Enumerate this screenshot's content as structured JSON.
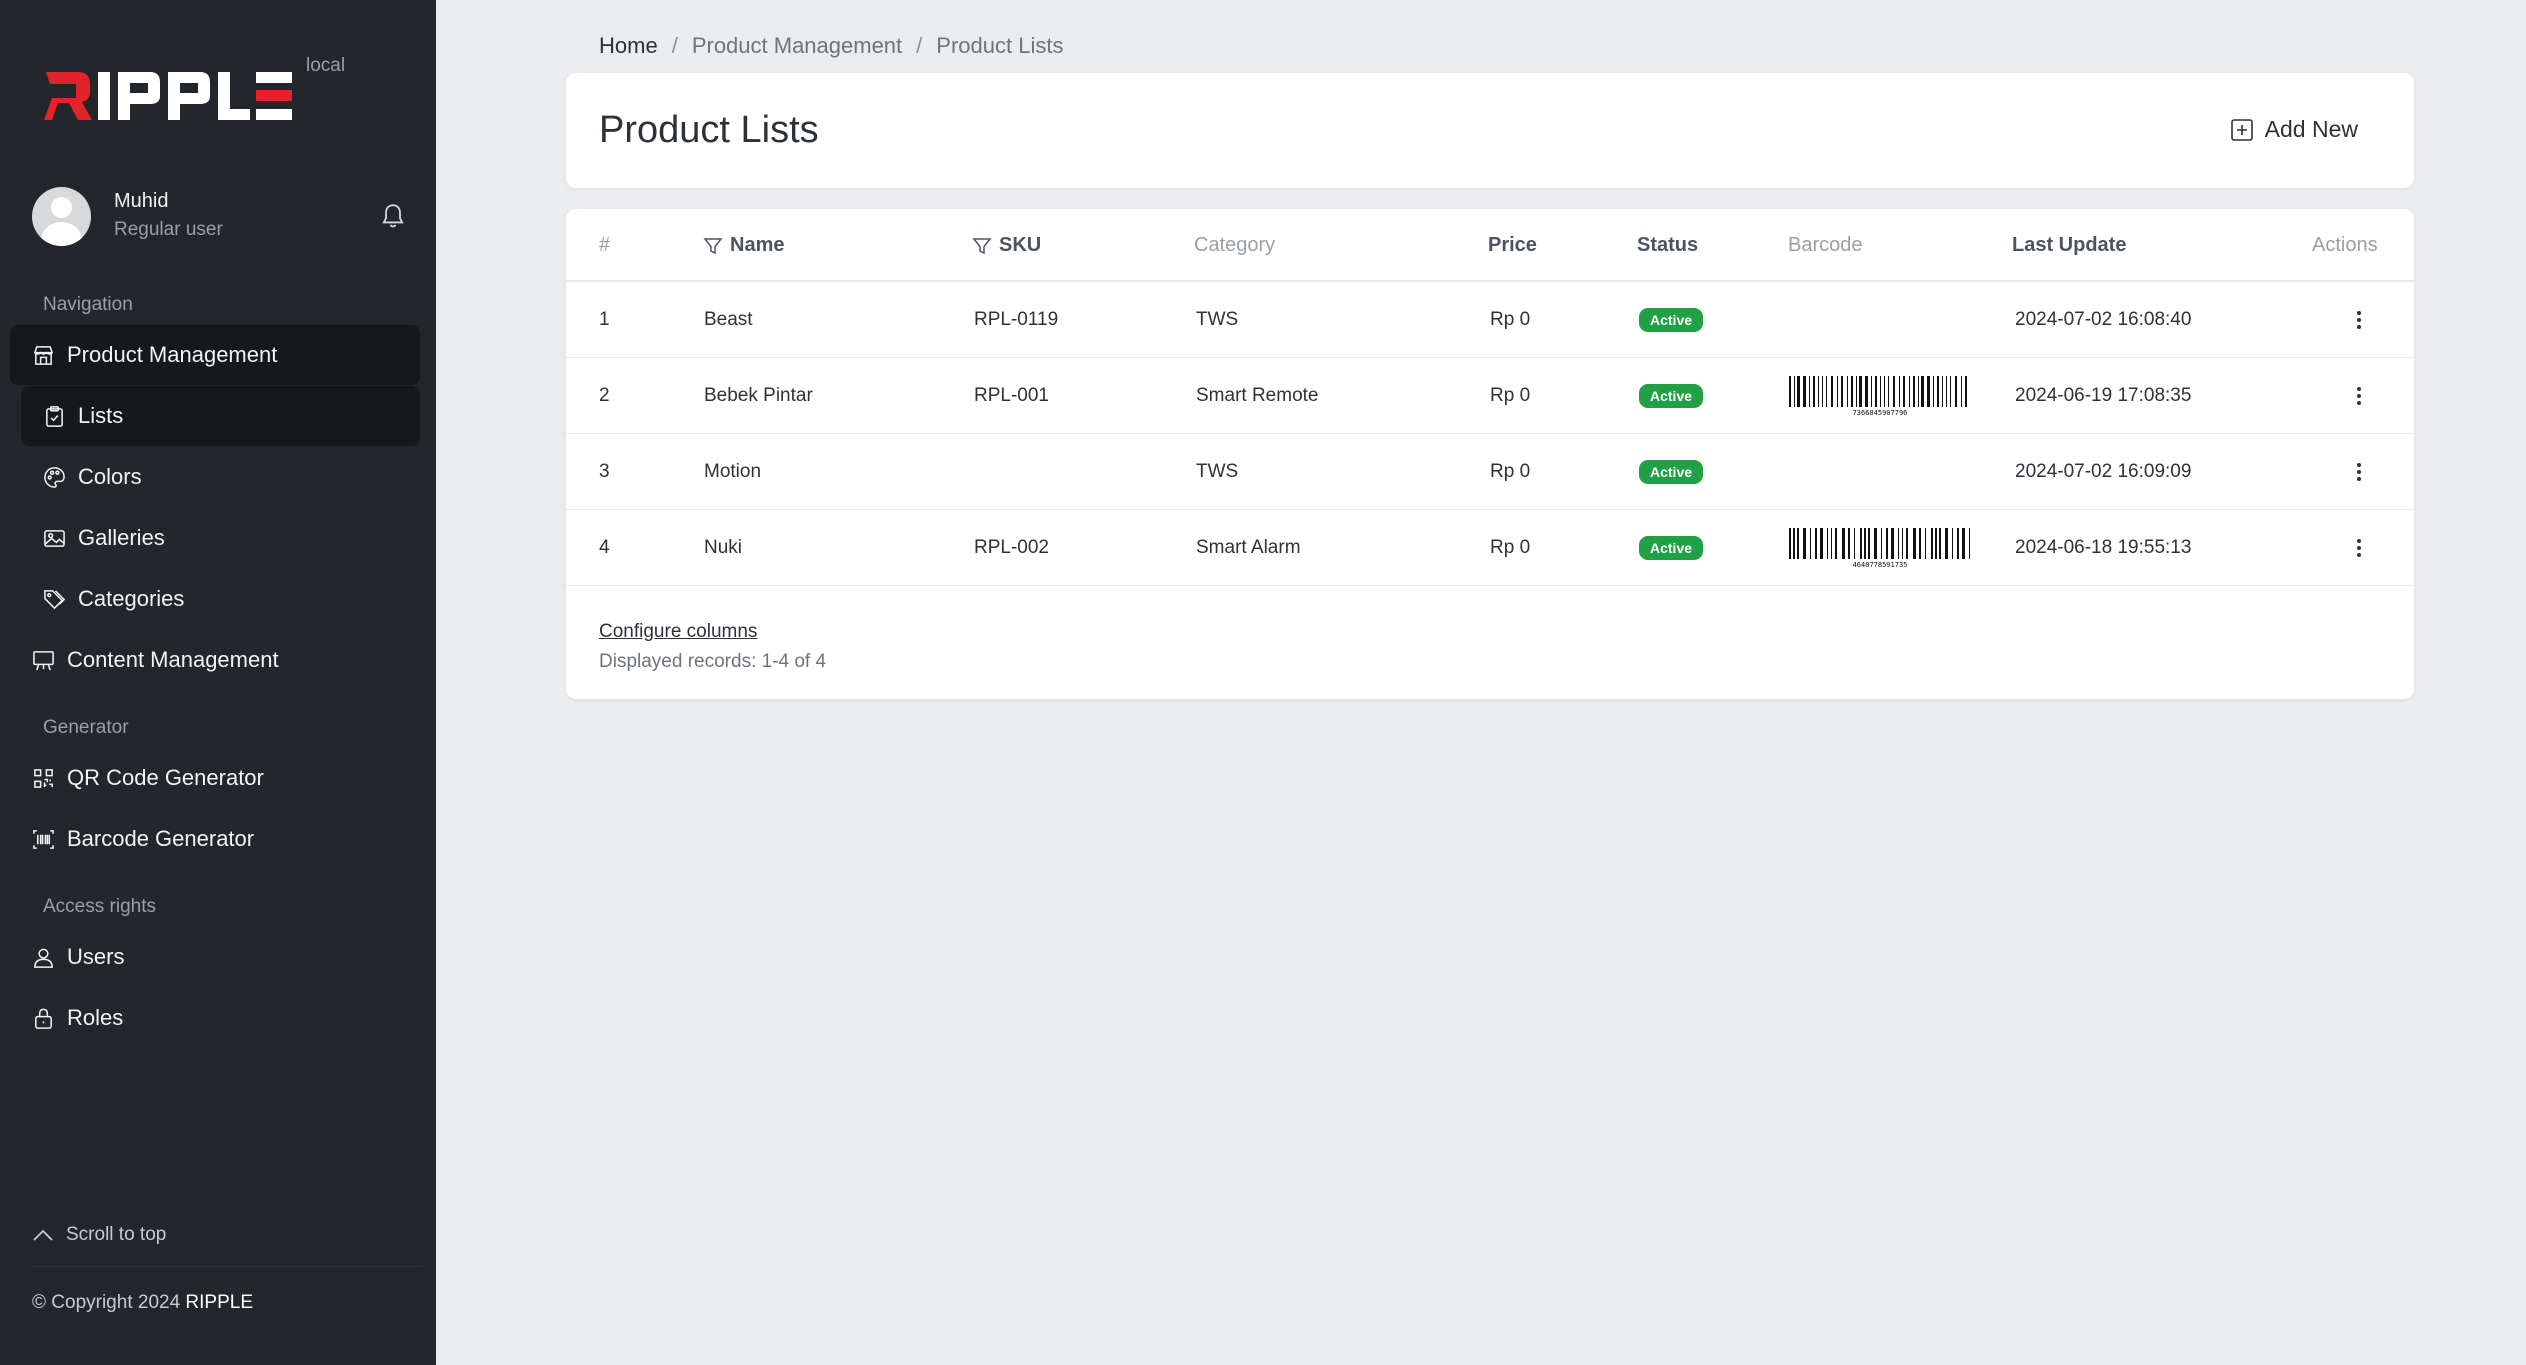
{
  "app": {
    "brand": "RIPPLE",
    "environment": "local",
    "brand_colors": {
      "accent_red": "#e3232a",
      "sidebar_bg": "#23262b",
      "active_bg": "#16181b",
      "status_green": "#21a146"
    }
  },
  "user": {
    "name": "Muhid",
    "role": "Regular user"
  },
  "sidebar": {
    "sections": {
      "navigation": "Navigation",
      "generator": "Generator",
      "access": "Access rights"
    },
    "items": {
      "product_management": {
        "label": "Product Management",
        "icon": "store-icon"
      },
      "lists": {
        "label": "Lists",
        "icon": "clipboard-check-icon"
      },
      "colors": {
        "label": "Colors",
        "icon": "palette-icon"
      },
      "galleries": {
        "label": "Galleries",
        "icon": "image-icon"
      },
      "categories": {
        "label": "Categories",
        "icon": "tags-icon"
      },
      "content_management": {
        "label": "Content Management",
        "icon": "easel-icon"
      },
      "qr_code": {
        "label": "QR Code Generator",
        "icon": "qr-code-icon"
      },
      "barcode": {
        "label": "Barcode Generator",
        "icon": "barcode-icon"
      },
      "users": {
        "label": "Users",
        "icon": "person-icon"
      },
      "roles": {
        "label": "Roles",
        "icon": "lock-icon"
      }
    },
    "scroll_top": "Scroll to top",
    "copyright_prefix": "© Copyright 2024",
    "copyright_brand": "RIPPLE"
  },
  "breadcrumb": {
    "home": "Home",
    "section": "Product Management",
    "current": "Product Lists",
    "separator": "/"
  },
  "page": {
    "title": "Product Lists",
    "add_new": "Add New"
  },
  "table": {
    "columns": {
      "index": "#",
      "name": "Name",
      "sku": "SKU",
      "category": "Category",
      "price": "Price",
      "status": "Status",
      "barcode": "Barcode",
      "last_update": "Last Update",
      "actions": "Actions"
    },
    "rows": [
      {
        "index": "1",
        "name": "Beast",
        "sku": "RPL-0119",
        "category": "TWS",
        "price": "Rp 0",
        "status": "Active",
        "barcode": "",
        "last_update": "2024-07-02 16:08:40"
      },
      {
        "index": "2",
        "name": "Bebek Pintar",
        "sku": "RPL-001",
        "category": "Smart Remote",
        "price": "Rp 0",
        "status": "Active",
        "barcode": "7366845907796",
        "last_update": "2024-06-19 17:08:35"
      },
      {
        "index": "3",
        "name": "Motion",
        "sku": "",
        "category": "TWS",
        "price": "Rp 0",
        "status": "Active",
        "barcode": "",
        "last_update": "2024-07-02 16:09:09"
      },
      {
        "index": "4",
        "name": "Nuki",
        "sku": "RPL-002",
        "category": "Smart Alarm",
        "price": "Rp 0",
        "status": "Active",
        "barcode": "4640778591735",
        "last_update": "2024-06-18 19:55:13"
      }
    ],
    "configure_columns": "Configure columns",
    "displayed_records": "Displayed records: 1-4 of 4"
  }
}
